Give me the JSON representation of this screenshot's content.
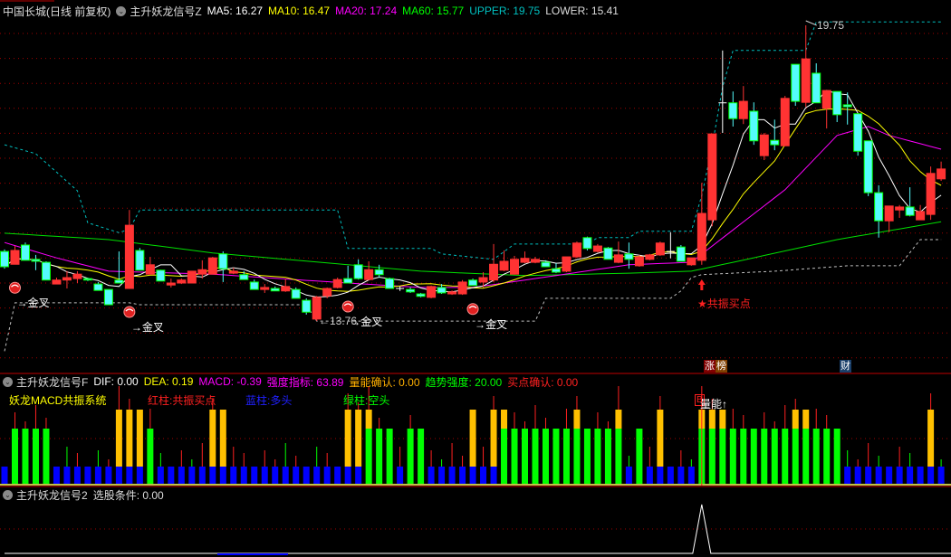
{
  "main_header": {
    "stock": "中国长城(日线 前复权)",
    "indicator": "主升妖龙信号Z",
    "ma5": "MA5: 16.27",
    "ma10": "MA10: 16.47",
    "ma20": "MA20: 17.24",
    "ma60": "MA60: 15.77",
    "upper": "UPPER: 19.75",
    "lower": "LOWER: 15.41"
  },
  "main_labels": {
    "golden_cross": "→金叉",
    "low_mark": "←13.76",
    "high_mark": "19.75",
    "resonance_buy": "★共振买点",
    "tag_zhang": "涨",
    "tag_bang": "榜",
    "tag_cai": "财"
  },
  "macd_panel": {
    "indicator": "主升妖龙信号F",
    "dif": "DIF: 0.00",
    "dea": "DEA: 0.19",
    "macd": "MACD: -0.39",
    "strength": "强度指标: 63.89",
    "volume_confirm": "量能确认: 0.00",
    "trend_strength": "趋势强度: 20.00",
    "buy_confirm": "买点确认: 0.00",
    "legend_title": "妖龙MACD共振系统",
    "legend_red": "红柱:共振买点",
    "legend_blue": "蓝柱:多头",
    "legend_green": "绿柱:空头",
    "volume_up": "量能↑",
    "b_mark": "B"
  },
  "select_panel": {
    "indicator": "主升妖龙信号2",
    "condition": "选股条件: 0.00"
  },
  "colors": {
    "up": "#ff3333",
    "down": "#54fcfc",
    "ma5": "#ffffff",
    "ma10": "#ffff00",
    "ma20": "#ff00ff",
    "ma60": "#00e000",
    "upper": "#00c0c0",
    "lower": "#c0c0c0"
  },
  "chart_data": {
    "type": "candlestick",
    "title": "中国长城(日线 前复权)",
    "candles_ohlc": [
      [
        15.17,
        15.21,
        14.82,
        14.86
      ],
      [
        14.91,
        15.28,
        14.91,
        15.19
      ],
      [
        15.3,
        15.35,
        14.99,
        14.99
      ],
      [
        15.01,
        15.1,
        14.79,
        14.97
      ],
      [
        14.95,
        14.97,
        14.59,
        14.59
      ],
      [
        14.51,
        14.64,
        14.51,
        14.59
      ],
      [
        14.59,
        14.77,
        14.42,
        14.64
      ],
      [
        14.62,
        14.77,
        14.53,
        14.71
      ],
      [
        14.62,
        14.64,
        14.57,
        14.59
      ],
      [
        14.51,
        14.55,
        14.38,
        14.38
      ],
      [
        14.4,
        14.4,
        14.09,
        14.09
      ],
      [
        14.59,
        15.17,
        14.53,
        14.53
      ],
      [
        14.42,
        16.01,
        14.42,
        15.7
      ],
      [
        15.19,
        15.24,
        14.79,
        14.79
      ],
      [
        14.71,
        15.06,
        14.71,
        14.9
      ],
      [
        14.79,
        14.8,
        14.57,
        14.57
      ],
      [
        14.49,
        14.62,
        14.44,
        14.53
      ],
      [
        14.53,
        14.62,
        14.51,
        14.59
      ],
      [
        14.53,
        14.77,
        14.53,
        14.77
      ],
      [
        14.71,
        14.99,
        14.62,
        14.8
      ],
      [
        14.71,
        15.06,
        14.71,
        15.04
      ],
      [
        15.12,
        15.17,
        14.55,
        14.82
      ],
      [
        14.73,
        14.84,
        14.71,
        14.77
      ],
      [
        14.7,
        14.77,
        14.6,
        14.6
      ],
      [
        14.55,
        14.6,
        14.4,
        14.4
      ],
      [
        14.4,
        14.51,
        14.33,
        14.44
      ],
      [
        14.42,
        14.46,
        14.37,
        14.37
      ],
      [
        14.37,
        14.62,
        14.35,
        14.46
      ],
      [
        14.4,
        14.44,
        14.22,
        14.22
      ],
      [
        14.18,
        14.22,
        13.89,
        13.94
      ],
      [
        13.8,
        14.27,
        13.76,
        14.24
      ],
      [
        14.27,
        14.44,
        14.22,
        14.42
      ],
      [
        14.44,
        14.64,
        14.42,
        14.6
      ],
      [
        14.62,
        14.88,
        14.53,
        14.53
      ],
      [
        14.9,
        15.01,
        14.6,
        14.62
      ],
      [
        14.6,
        14.97,
        14.59,
        14.8
      ],
      [
        14.8,
        14.9,
        14.64,
        14.7
      ],
      [
        14.62,
        14.64,
        14.42,
        14.42
      ],
      [
        14.42,
        14.46,
        14.37,
        14.42
      ],
      [
        14.4,
        14.44,
        14.33,
        14.35
      ],
      [
        14.31,
        14.33,
        14.24,
        14.26
      ],
      [
        14.24,
        14.48,
        14.22,
        14.46
      ],
      [
        14.44,
        14.51,
        14.31,
        14.33
      ],
      [
        14.31,
        14.38,
        14.29,
        14.35
      ],
      [
        14.31,
        14.59,
        14.29,
        14.55
      ],
      [
        14.59,
        14.62,
        14.48,
        14.48
      ],
      [
        14.55,
        14.75,
        14.44,
        14.64
      ],
      [
        14.59,
        15.32,
        14.55,
        14.91
      ],
      [
        14.79,
        15.19,
        14.77,
        14.97
      ],
      [
        14.71,
        15.08,
        14.7,
        15.01
      ],
      [
        14.95,
        15.17,
        14.93,
        15.03
      ],
      [
        14.95,
        15.06,
        14.93,
        15.01
      ],
      [
        14.95,
        14.99,
        14.86,
        14.86
      ],
      [
        14.82,
        14.93,
        14.73,
        14.75
      ],
      [
        14.77,
        15.06,
        14.75,
        15.06
      ],
      [
        15.06,
        15.37,
        15.04,
        15.34
      ],
      [
        15.45,
        15.47,
        15.19,
        15.23
      ],
      [
        15.17,
        15.32,
        15.15,
        15.28
      ],
      [
        15.24,
        15.26,
        15.01,
        15.01
      ],
      [
        14.95,
        15.37,
        14.93,
        15.1
      ],
      [
        15.12,
        15.35,
        14.82,
        15.01
      ],
      [
        14.88,
        15.1,
        14.86,
        15.06
      ],
      [
        15.01,
        15.12,
        14.99,
        15.1
      ],
      [
        15.1,
        15.37,
        15.08,
        15.34
      ],
      [
        15.17,
        15.56,
        15.03,
        15.17
      ],
      [
        15.26,
        15.3,
        14.97,
        14.97
      ],
      [
        14.9,
        15.04,
        14.88,
        15.04
      ],
      [
        14.99,
        16.56,
        14.9,
        15.94
      ],
      [
        15.81,
        17.55,
        15.68,
        17.55
      ],
      [
        18.18,
        19.24,
        17.57,
        18.18
      ],
      [
        18.18,
        18.41,
        17.7,
        17.86
      ],
      [
        17.86,
        18.52,
        17.75,
        18.21
      ],
      [
        18.01,
        18.19,
        17.33,
        17.41
      ],
      [
        17.11,
        17.57,
        17.02,
        17.53
      ],
      [
        17.42,
        17.84,
        17.22,
        17.33
      ],
      [
        17.31,
        18.32,
        17.31,
        18.27
      ],
      [
        18.96,
        18.96,
        18.12,
        18.21
      ],
      [
        18.19,
        19.75,
        18.1,
        19.07
      ],
      [
        18.78,
        18.98,
        18.18,
        18.18
      ],
      [
        18.07,
        18.43,
        17.66,
        18.43
      ],
      [
        18.41,
        18.41,
        17.79,
        17.94
      ],
      [
        18.14,
        18.39,
        17.74,
        18.1
      ],
      [
        17.96,
        17.96,
        17.11,
        17.2
      ],
      [
        17.41,
        17.41,
        16.29,
        16.36
      ],
      [
        16.36,
        16.51,
        15.45,
        15.79
      ],
      [
        15.79,
        16.09,
        15.56,
        16.09
      ],
      [
        16.01,
        16.11,
        15.85,
        16.07
      ],
      [
        16.07,
        16.47,
        15.88,
        15.9
      ],
      [
        15.81,
        16.11,
        15.81,
        15.98
      ],
      [
        15.92,
        16.89,
        15.81,
        16.75
      ],
      [
        16.64,
        16.99,
        16.6,
        16.84
      ]
    ],
    "ma20_points": [
      [
        0,
        15.35
      ],
      [
        5,
        15.04
      ],
      [
        10,
        14.77
      ],
      [
        20,
        14.71
      ],
      [
        30,
        14.57
      ],
      [
        40,
        14.44
      ],
      [
        45,
        14.44
      ],
      [
        50,
        14.59
      ],
      [
        60,
        14.9
      ],
      [
        66,
        14.95
      ],
      [
        68,
        15.28
      ],
      [
        75,
        16.42
      ],
      [
        80,
        17.52
      ],
      [
        83,
        17.7
      ],
      [
        85,
        17.52
      ],
      [
        90,
        17.24
      ]
    ],
    "ma60_points": [
      [
        0,
        15.54
      ],
      [
        10,
        15.41
      ],
      [
        20,
        15.14
      ],
      [
        40,
        14.77
      ],
      [
        50,
        14.68
      ],
      [
        60,
        14.73
      ],
      [
        66,
        14.77
      ],
      [
        70,
        14.95
      ],
      [
        80,
        15.41
      ],
      [
        90,
        15.77
      ]
    ],
    "upper_points": [
      [
        0,
        17.33
      ],
      [
        3,
        17.15
      ],
      [
        7,
        16.4
      ],
      [
        8,
        15.75
      ],
      [
        11,
        15.55
      ],
      [
        12,
        15.62
      ],
      [
        13,
        16.01
      ],
      [
        32,
        16.01
      ],
      [
        33,
        15.23
      ],
      [
        41,
        15.23
      ],
      [
        42,
        15.12
      ],
      [
        47,
        15.01
      ],
      [
        49,
        15.32
      ],
      [
        56,
        15.32
      ],
      [
        57,
        15.45
      ],
      [
        60,
        15.45
      ],
      [
        61,
        15.58
      ],
      [
        66,
        15.58
      ],
      [
        67,
        16.3
      ],
      [
        68,
        17.3
      ],
      [
        69,
        18.5
      ],
      [
        70,
        19.24
      ],
      [
        77,
        19.24
      ],
      [
        78,
        19.82
      ],
      [
        90,
        19.82
      ]
    ],
    "lower_points": [
      [
        0,
        13.15
      ],
      [
        1,
        14.13
      ],
      [
        12,
        14.13
      ],
      [
        13,
        14.09
      ],
      [
        29,
        14.09
      ],
      [
        30,
        13.76
      ],
      [
        51,
        13.76
      ],
      [
        52,
        14.22
      ],
      [
        64,
        14.22
      ],
      [
        65,
        14.37
      ],
      [
        66,
        14.64
      ],
      [
        67,
        14.7
      ],
      [
        74,
        14.77
      ],
      [
        81,
        14.88
      ],
      [
        86,
        14.88
      ],
      [
        88,
        15.41
      ],
      [
        90,
        15.41
      ]
    ],
    "golden_cross_indices": [
      1,
      12,
      33,
      45
    ],
    "low_index": 30,
    "high_index": 77,
    "resonance_buy_index": 67,
    "macd_bar_types": [
      "B",
      "G",
      "G",
      "G",
      "G",
      "B",
      "B",
      "B",
      "B",
      "B",
      "B",
      "OB",
      "OB",
      "OB",
      "G",
      "B",
      "B",
      "B",
      "B",
      "B",
      "OB",
      "OB",
      "B",
      "B",
      "B",
      "B",
      "B",
      "B",
      "B",
      "B",
      "B",
      "B",
      "B",
      "OB",
      "OB",
      "OG",
      "G",
      "G",
      "B",
      "G",
      "G",
      "B",
      "B",
      "B",
      "B",
      "OB",
      "B",
      "OB",
      "OG",
      "G",
      "G",
      "G",
      "G",
      "G",
      "G",
      "OG",
      "G",
      "G",
      "G",
      "OG",
      "B",
      "G",
      "B",
      "OB",
      "B",
      "B",
      "B",
      "OG",
      "OG",
      "OG",
      "G",
      "G",
      "G",
      "G",
      "G",
      "G",
      "OG",
      "OG",
      "G",
      "G",
      "G",
      "B",
      "B",
      "B",
      "B",
      "B",
      "B",
      "B",
      "B",
      "OB",
      "B"
    ],
    "select_signal_index": 67
  }
}
